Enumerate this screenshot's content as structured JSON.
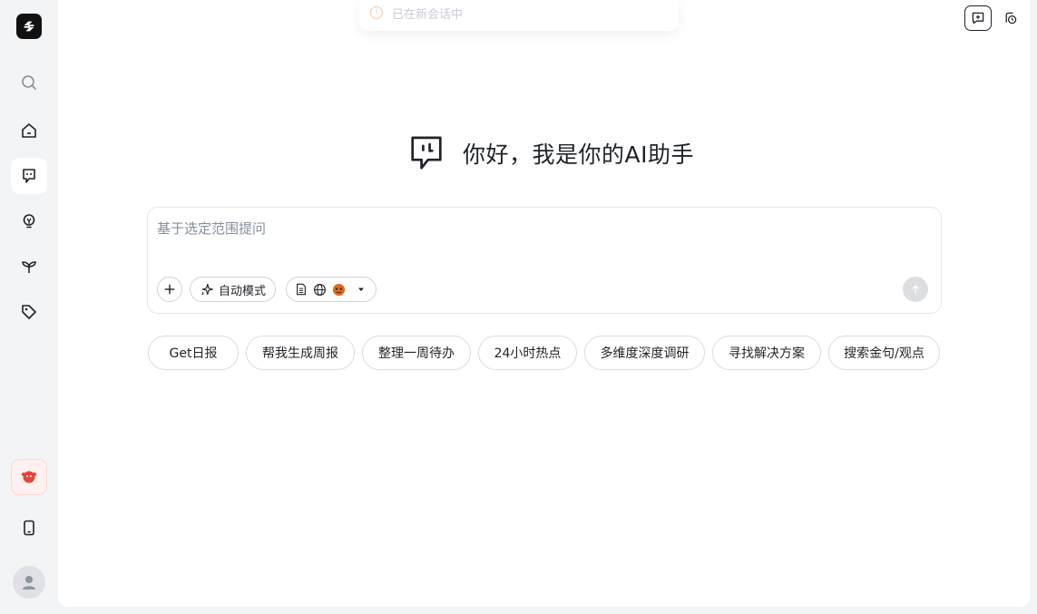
{
  "sidebar": {
    "items": [
      {
        "name": "search",
        "icon": "search-icon"
      },
      {
        "name": "home",
        "icon": "home-icon"
      },
      {
        "name": "chat",
        "icon": "chat-face-icon",
        "active": true
      },
      {
        "name": "ideas",
        "icon": "lightbulb-icon"
      },
      {
        "name": "grow",
        "icon": "sprout-icon"
      },
      {
        "name": "tags",
        "icon": "tag-icon"
      }
    ],
    "bottom": [
      {
        "name": "mascot",
        "icon": "mascot-icon"
      },
      {
        "name": "mobile",
        "icon": "mobile-phone-icon"
      },
      {
        "name": "user",
        "icon": "user-avatar-icon"
      }
    ]
  },
  "toast": {
    "text": "已在新会话中",
    "icon": "info-icon"
  },
  "hero": {
    "title": "你好，我是你的AI助手"
  },
  "composer": {
    "placeholder": "基于选定范围提问",
    "mode_label": "自动模式"
  },
  "suggestions": [
    "Get日报",
    "帮我生成周报",
    "整理一周待办",
    "24小时热点",
    "多维度深度调研",
    "寻找解决方案",
    "搜索金句/观点"
  ],
  "colors": {
    "accent": "#1f2329",
    "sidebar_bg": "#f3f4f6",
    "border": "#e5e6eb",
    "send_disabled": "#dcdee2"
  }
}
